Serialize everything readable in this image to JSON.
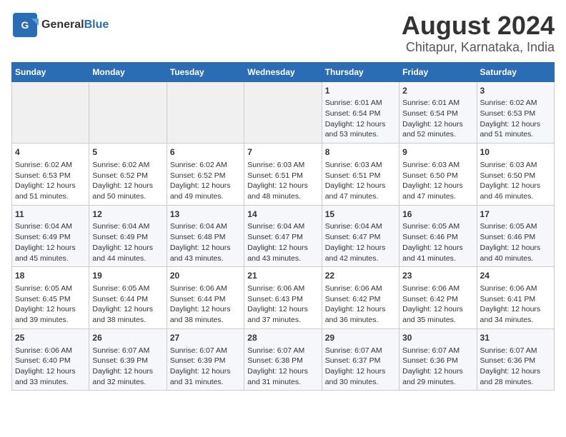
{
  "header": {
    "logo_general": "General",
    "logo_blue": "Blue",
    "title": "August 2024",
    "subtitle": "Chitapur, Karnataka, India"
  },
  "days_of_week": [
    "Sunday",
    "Monday",
    "Tuesday",
    "Wednesday",
    "Thursday",
    "Friday",
    "Saturday"
  ],
  "weeks": [
    [
      {
        "day": "",
        "content": ""
      },
      {
        "day": "",
        "content": ""
      },
      {
        "day": "",
        "content": ""
      },
      {
        "day": "",
        "content": ""
      },
      {
        "day": "1",
        "content": "Sunrise: 6:01 AM\nSunset: 6:54 PM\nDaylight: 12 hours\nand 53 minutes."
      },
      {
        "day": "2",
        "content": "Sunrise: 6:01 AM\nSunset: 6:54 PM\nDaylight: 12 hours\nand 52 minutes."
      },
      {
        "day": "3",
        "content": "Sunrise: 6:02 AM\nSunset: 6:53 PM\nDaylight: 12 hours\nand 51 minutes."
      }
    ],
    [
      {
        "day": "4",
        "content": "Sunrise: 6:02 AM\nSunset: 6:53 PM\nDaylight: 12 hours\nand 51 minutes."
      },
      {
        "day": "5",
        "content": "Sunrise: 6:02 AM\nSunset: 6:52 PM\nDaylight: 12 hours\nand 50 minutes."
      },
      {
        "day": "6",
        "content": "Sunrise: 6:02 AM\nSunset: 6:52 PM\nDaylight: 12 hours\nand 49 minutes."
      },
      {
        "day": "7",
        "content": "Sunrise: 6:03 AM\nSunset: 6:51 PM\nDaylight: 12 hours\nand 48 minutes."
      },
      {
        "day": "8",
        "content": "Sunrise: 6:03 AM\nSunset: 6:51 PM\nDaylight: 12 hours\nand 47 minutes."
      },
      {
        "day": "9",
        "content": "Sunrise: 6:03 AM\nSunset: 6:50 PM\nDaylight: 12 hours\nand 47 minutes."
      },
      {
        "day": "10",
        "content": "Sunrise: 6:03 AM\nSunset: 6:50 PM\nDaylight: 12 hours\nand 46 minutes."
      }
    ],
    [
      {
        "day": "11",
        "content": "Sunrise: 6:04 AM\nSunset: 6:49 PM\nDaylight: 12 hours\nand 45 minutes."
      },
      {
        "day": "12",
        "content": "Sunrise: 6:04 AM\nSunset: 6:49 PM\nDaylight: 12 hours\nand 44 minutes."
      },
      {
        "day": "13",
        "content": "Sunrise: 6:04 AM\nSunset: 6:48 PM\nDaylight: 12 hours\nand 43 minutes."
      },
      {
        "day": "14",
        "content": "Sunrise: 6:04 AM\nSunset: 6:47 PM\nDaylight: 12 hours\nand 43 minutes."
      },
      {
        "day": "15",
        "content": "Sunrise: 6:04 AM\nSunset: 6:47 PM\nDaylight: 12 hours\nand 42 minutes."
      },
      {
        "day": "16",
        "content": "Sunrise: 6:05 AM\nSunset: 6:46 PM\nDaylight: 12 hours\nand 41 minutes."
      },
      {
        "day": "17",
        "content": "Sunrise: 6:05 AM\nSunset: 6:46 PM\nDaylight: 12 hours\nand 40 minutes."
      }
    ],
    [
      {
        "day": "18",
        "content": "Sunrise: 6:05 AM\nSunset: 6:45 PM\nDaylight: 12 hours\nand 39 minutes."
      },
      {
        "day": "19",
        "content": "Sunrise: 6:05 AM\nSunset: 6:44 PM\nDaylight: 12 hours\nand 38 minutes."
      },
      {
        "day": "20",
        "content": "Sunrise: 6:06 AM\nSunset: 6:44 PM\nDaylight: 12 hours\nand 38 minutes."
      },
      {
        "day": "21",
        "content": "Sunrise: 6:06 AM\nSunset: 6:43 PM\nDaylight: 12 hours\nand 37 minutes."
      },
      {
        "day": "22",
        "content": "Sunrise: 6:06 AM\nSunset: 6:42 PM\nDaylight: 12 hours\nand 36 minutes."
      },
      {
        "day": "23",
        "content": "Sunrise: 6:06 AM\nSunset: 6:42 PM\nDaylight: 12 hours\nand 35 minutes."
      },
      {
        "day": "24",
        "content": "Sunrise: 6:06 AM\nSunset: 6:41 PM\nDaylight: 12 hours\nand 34 minutes."
      }
    ],
    [
      {
        "day": "25",
        "content": "Sunrise: 6:06 AM\nSunset: 6:40 PM\nDaylight: 12 hours\nand 33 minutes."
      },
      {
        "day": "26",
        "content": "Sunrise: 6:07 AM\nSunset: 6:39 PM\nDaylight: 12 hours\nand 32 minutes."
      },
      {
        "day": "27",
        "content": "Sunrise: 6:07 AM\nSunset: 6:39 PM\nDaylight: 12 hours\nand 31 minutes."
      },
      {
        "day": "28",
        "content": "Sunrise: 6:07 AM\nSunset: 6:38 PM\nDaylight: 12 hours\nand 31 minutes."
      },
      {
        "day": "29",
        "content": "Sunrise: 6:07 AM\nSunset: 6:37 PM\nDaylight: 12 hours\nand 30 minutes."
      },
      {
        "day": "30",
        "content": "Sunrise: 6:07 AM\nSunset: 6:36 PM\nDaylight: 12 hours\nand 29 minutes."
      },
      {
        "day": "31",
        "content": "Sunrise: 6:07 AM\nSunset: 6:36 PM\nDaylight: 12 hours\nand 28 minutes."
      }
    ]
  ]
}
